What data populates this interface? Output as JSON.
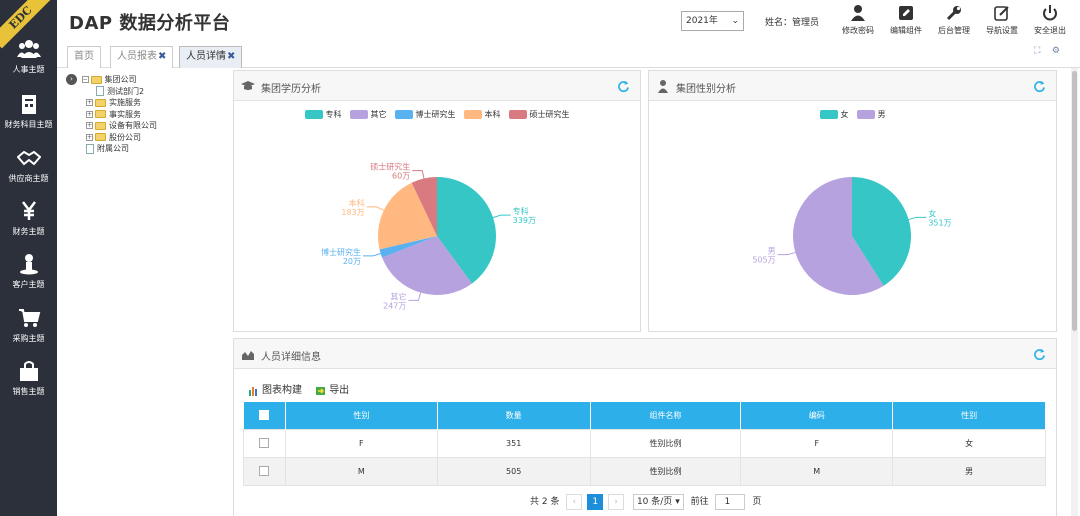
{
  "brand_ribbon": "EDC",
  "app_title": "DAP 数据分析平台",
  "sidebar": {
    "items": [
      {
        "label": "人事主题",
        "icon": "people-icon"
      },
      {
        "label": "财务科目主题",
        "icon": "ledger-icon"
      },
      {
        "label": "供应商主题",
        "icon": "handshake-icon"
      },
      {
        "label": "财务主题",
        "icon": "yen-icon"
      },
      {
        "label": "客户主题",
        "icon": "person-icon"
      },
      {
        "label": "采购主题",
        "icon": "cart-icon"
      },
      {
        "label": "销售主题",
        "icon": "bag-icon"
      }
    ]
  },
  "header": {
    "year": "2021年",
    "user": "姓名：管理员",
    "toolbar": [
      {
        "label": "修改密码",
        "icon": "user-key-icon"
      },
      {
        "label": "编辑组件",
        "icon": "edit-icon"
      },
      {
        "label": "后台管理",
        "icon": "wrench-icon"
      },
      {
        "label": "导航设置",
        "icon": "settings-edit-icon"
      },
      {
        "label": "安全退出",
        "icon": "power-icon"
      }
    ]
  },
  "tabs": {
    "home": "首页",
    "report": "人员报表",
    "detail": "人员详情",
    "close_mark": "✖"
  },
  "tree": {
    "root": "集团公司",
    "children": [
      "测试部门2",
      "实施服务",
      "事实服务",
      "设备有限公司",
      "股份公司"
    ],
    "sibling": "附属公司"
  },
  "education_panel": {
    "title": "集团学历分析"
  },
  "gender_panel": {
    "title": "集团性别分析"
  },
  "detail_panel": {
    "title": "人员详细信息",
    "tool_build": "图表构建",
    "tool_export": "导出"
  },
  "colors": {
    "teal": "#36c6c6",
    "purple": "#b6a2de",
    "blue": "#5ab1ef",
    "orange": "#ffb980",
    "red": "#d87a80",
    "header_blue": "#2db0ea"
  },
  "chart_data": [
    {
      "type": "pie",
      "series": [
        {
          "name": "专科",
          "value": 339,
          "label": "339万",
          "color": "#36c6c6"
        },
        {
          "name": "其它",
          "value": 247,
          "label": "247万",
          "color": "#b6a2de"
        },
        {
          "name": "博士研究生",
          "value": 20,
          "label": "20万",
          "color": "#5ab1ef"
        },
        {
          "name": "本科",
          "value": 183,
          "label": "183万",
          "color": "#ffb980"
        },
        {
          "name": "硕士研究生",
          "value": 60,
          "label": "60万",
          "color": "#d87a80"
        }
      ],
      "legend_position": "top"
    },
    {
      "type": "pie",
      "series": [
        {
          "name": "女",
          "value": 351,
          "label": "351万",
          "color": "#36c6c6"
        },
        {
          "name": "男",
          "value": 505,
          "label": "505万",
          "color": "#b6a2de"
        }
      ],
      "legend_position": "top"
    }
  ],
  "table": {
    "columns": [
      "性别",
      "数量",
      "组件名称",
      "编码",
      "性别"
    ],
    "rows": [
      [
        "F",
        "351",
        "性别比例",
        "F",
        "女"
      ],
      [
        "M",
        "505",
        "性别比例",
        "M",
        "男"
      ]
    ]
  },
  "pagination": {
    "total": "共 2 条",
    "prev": "‹",
    "current": "1",
    "next": "›",
    "page_size": "10 条/页",
    "goto": "前往",
    "goto_value": "1",
    "page_unit": "页"
  }
}
